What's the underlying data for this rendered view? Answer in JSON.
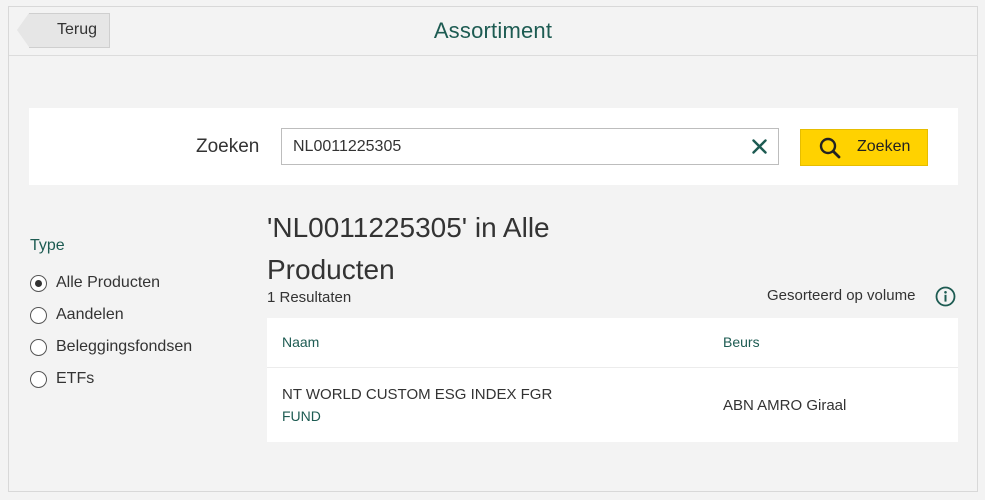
{
  "header": {
    "back_label": "Terug",
    "title": "Assortiment"
  },
  "search": {
    "label": "Zoeken",
    "value": "NL0011225305",
    "button_label": "Zoeken"
  },
  "filters": {
    "title": "Type",
    "options": [
      {
        "label": "Alle Producten",
        "checked": true
      },
      {
        "label": "Aandelen",
        "checked": false
      },
      {
        "label": "Beleggingsfondsen",
        "checked": false
      },
      {
        "label": "ETFs",
        "checked": false
      }
    ]
  },
  "results": {
    "title": "'NL0011225305' in Alle Producten",
    "count": "1 Resultaten",
    "sort_label": "Gesorteerd op volume",
    "columns": {
      "name": "Naam",
      "exchange": "Beurs"
    },
    "rows": [
      {
        "name": "NT WORLD CUSTOM ESG INDEX FGR",
        "type": "FUND",
        "exchange": "ABN AMRO Giraal"
      }
    ]
  },
  "colors": {
    "accent": "#1d5b52",
    "button": "#ffd200",
    "background": "#f3f3f3"
  },
  "icons": [
    "arrow-left-icon",
    "clear-icon",
    "search-icon",
    "info-icon"
  ]
}
